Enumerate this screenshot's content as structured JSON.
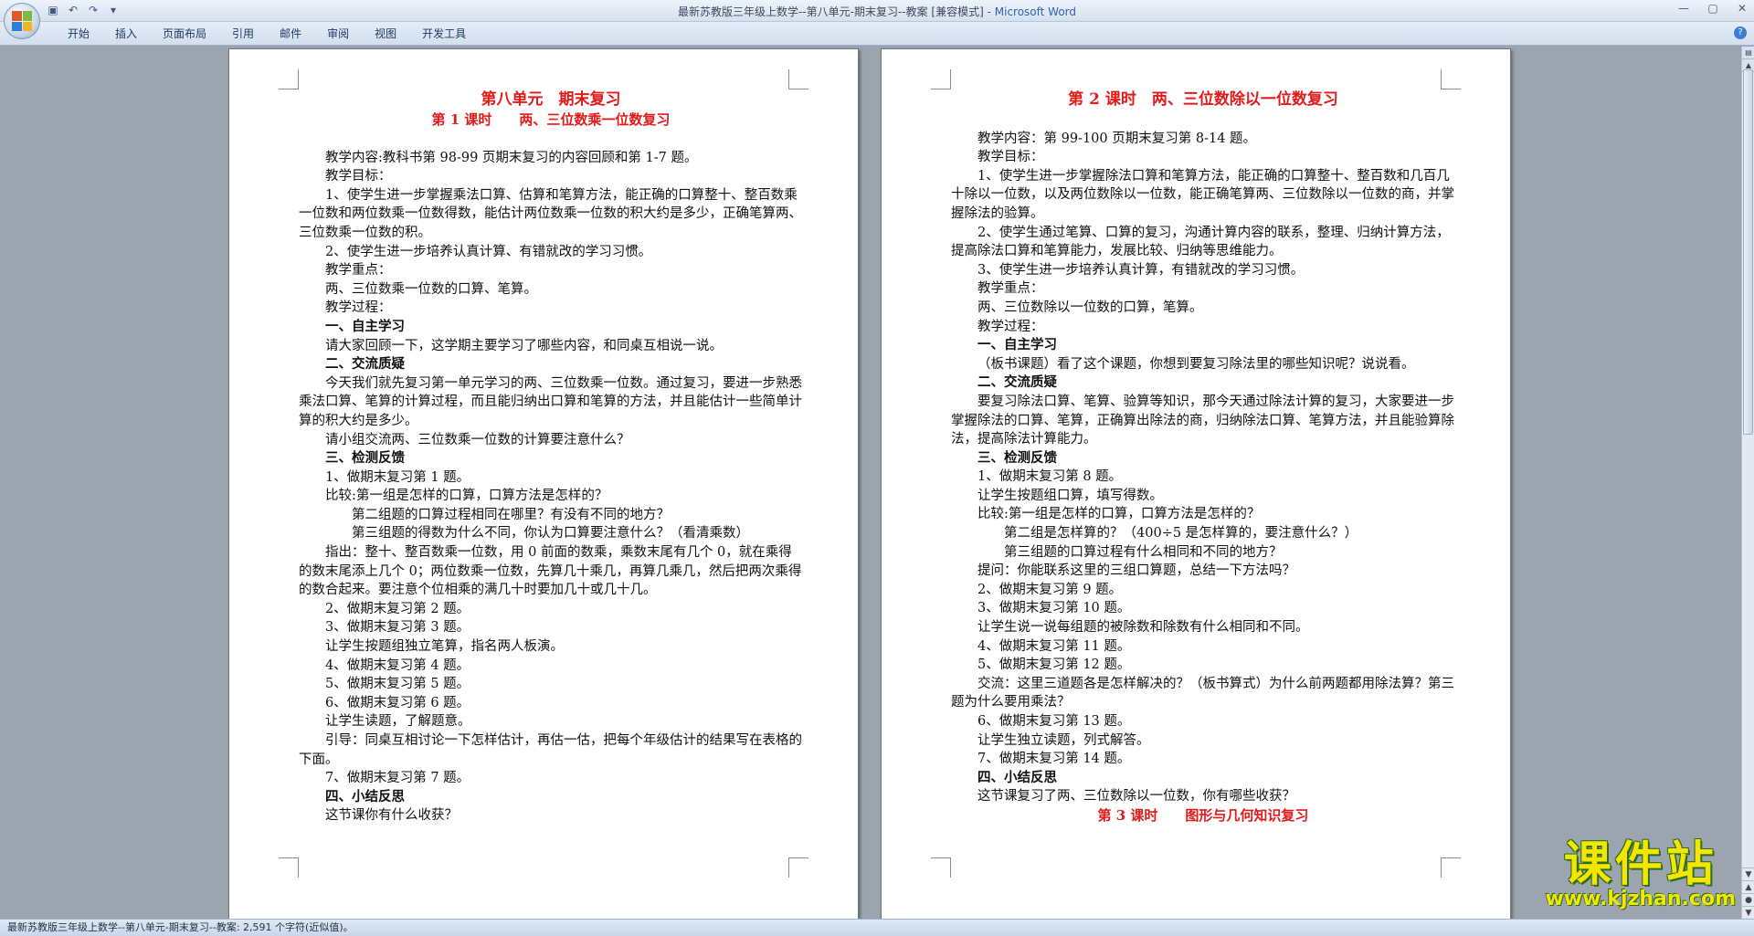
{
  "window": {
    "title_doc": "最新苏教版三年级上数学--第八单元-期末复习--教案 [兼容模式]",
    "title_app": " - Microsoft Word"
  },
  "ribbon": {
    "tabs": [
      "开始",
      "插入",
      "页面布局",
      "引用",
      "邮件",
      "审阅",
      "视图",
      "开发工具"
    ]
  },
  "colors": {
    "accent_red": "#e21a1a",
    "watermark_yellow": "#f5e600"
  },
  "icons": [
    "office-button-icon",
    "save-icon",
    "undo-icon",
    "redo-icon",
    "customize-icon",
    "minimize-icon",
    "maximize-icon",
    "close-icon",
    "help-icon"
  ],
  "page1": {
    "title": "第八单元　期末复习",
    "subtitle": "第 1 课时　　两、三位数乘一位数复习",
    "lines": [
      "教学内容:教科书第 98-99 页期末复习的内容回顾和第 1-7 题。",
      "教学目标：",
      "1、使学生进一步掌握乘法口算、估算和笔算方法，能正确的口算整十、整百数乘一位数和两位数乘一位数得数，能估计两位数乘一位数的积大约是多少，正确笔算两、三位数乘一位数的积。",
      "2、使学生进一步培养认真计算、有错就改的学习习惯。",
      "教学重点：",
      "两、三位数乘一位数的口算、笔算。",
      "教学过程：",
      "一、自主学习",
      "请大家回顾一下，这学期主要学习了哪些内容，和同桌互相说一说。",
      "二、交流质疑",
      "今天我们就先复习第一单元学习的两、三位数乘一位数。通过复习，要进一步熟悉乘法口算、笔算的计算过程，而且能归纳出口算和笔算的方法，并且能估计一些简单计算的积大约是多少。",
      "请小组交流两、三位数乘一位数的计算要注意什么？",
      "三、检测反馈",
      "1、做期末复习第 1 题。",
      "比较:第一组是怎样的口算，口算方法是怎样的？",
      "第二组题的口算过程相同在哪里？有没有不同的地方？",
      "第三组题的得数为什么不同，你认为口算要注意什么？（看清乘数）",
      "指出：整十、整百数乘一位数，用 0 前面的数乘，乘数末尾有几个 0，就在乘得的数末尾添上几个 0；两位数乘一位数，先算几十乘几，再算几乘几，然后把两次乘得的数合起来。要注意个位相乘的满几十时要加几十或几十几。",
      "2、做期末复习第 2 题。",
      "3、做期末复习第 3 题。",
      "让学生按题组独立笔算，指名两人板演。",
      "4、做期末复习第 4 题。",
      "5、做期末复习第 5 题。",
      "6、做期末复习第 6 题。",
      "让学生读题，了解题意。",
      "引导：同桌互相讨论一下怎样估计，再估一估，把每个年级估计的结果写在表格的下面。",
      "7、做期末复习第 7 题。",
      "四、小结反思",
      "这节课你有什么收获？"
    ]
  },
  "page2": {
    "title": "第 2 课时　两、三位数除以一位数复习",
    "lines": [
      "教学内容：第 99-100 页期末复习第 8-14 题。",
      "教学目标：",
      "1、使学生进一步掌握除法口算和笔算方法，能正确的口算整十、整百数和几百几十除以一位数，以及两位数除以一位数，能正确笔算两、三位数除以一位数的商，并掌握除法的验算。",
      "2、使学生通过笔算、口算的复习，沟通计算内容的联系，整理、归纳计算方法，提高除法口算和笔算能力，发展比较、归纳等思维能力。",
      "3、使学生进一步培养认真计算，有错就改的学习习惯。",
      "教学重点：",
      "两、三位数除以一位数的口算，笔算。",
      "教学过程：",
      "一、自主学习",
      "（板书课题）看了这个课题，你想到要复习除法里的哪些知识呢？说说看。",
      "二、交流质疑",
      "要复习除法口算、笔算、验算等知识，那今天通过除法计算的复习，大家要进一步掌握除法的口算、笔算，正确算出除法的商，归纳除法口算、笔算方法，并且能验算除法，提高除法计算能力。",
      "三、检测反馈",
      "1、做期末复习第 8 题。",
      "让学生按题组口算，填写得数。",
      "比较:第一组是怎样的口算，口算方法是怎样的？",
      "第二组是怎样算的？（400÷5 是怎样算的，要注意什么？）",
      "第三组题的口算过程有什么相同和不同的地方？",
      "提问：你能联系这里的三组口算题，总结一下方法吗？",
      "2、做期末复习第 9 题。",
      "3、做期末复习第 10 题。",
      "让学生说一说每组题的被除数和除数有什么相同和不同。",
      "4、做期末复习第 11 题。",
      "5、做期末复习第 12 题。",
      "交流：这里三道题各是怎样解决的？（板书算式）为什么前两题都用除法算？第三题为什么要用乘法？",
      "6、做期末复习第 13 题。",
      "让学生独立读题，列式解答。",
      "7、做期末复习第 14 题。",
      "四、小结反思",
      "这节课复习了两、三位数除以一位数，你有哪些收获？"
    ],
    "next_title": "第 3 课时　　图形与几何知识复习"
  },
  "statusbar": {
    "text": "最新苏教版三年级上数学--第八单元-期末复习--教案: 2,591 个字符(近似值)。"
  },
  "watermark": {
    "main": "课件站",
    "url": "www.kjzhan.com"
  }
}
